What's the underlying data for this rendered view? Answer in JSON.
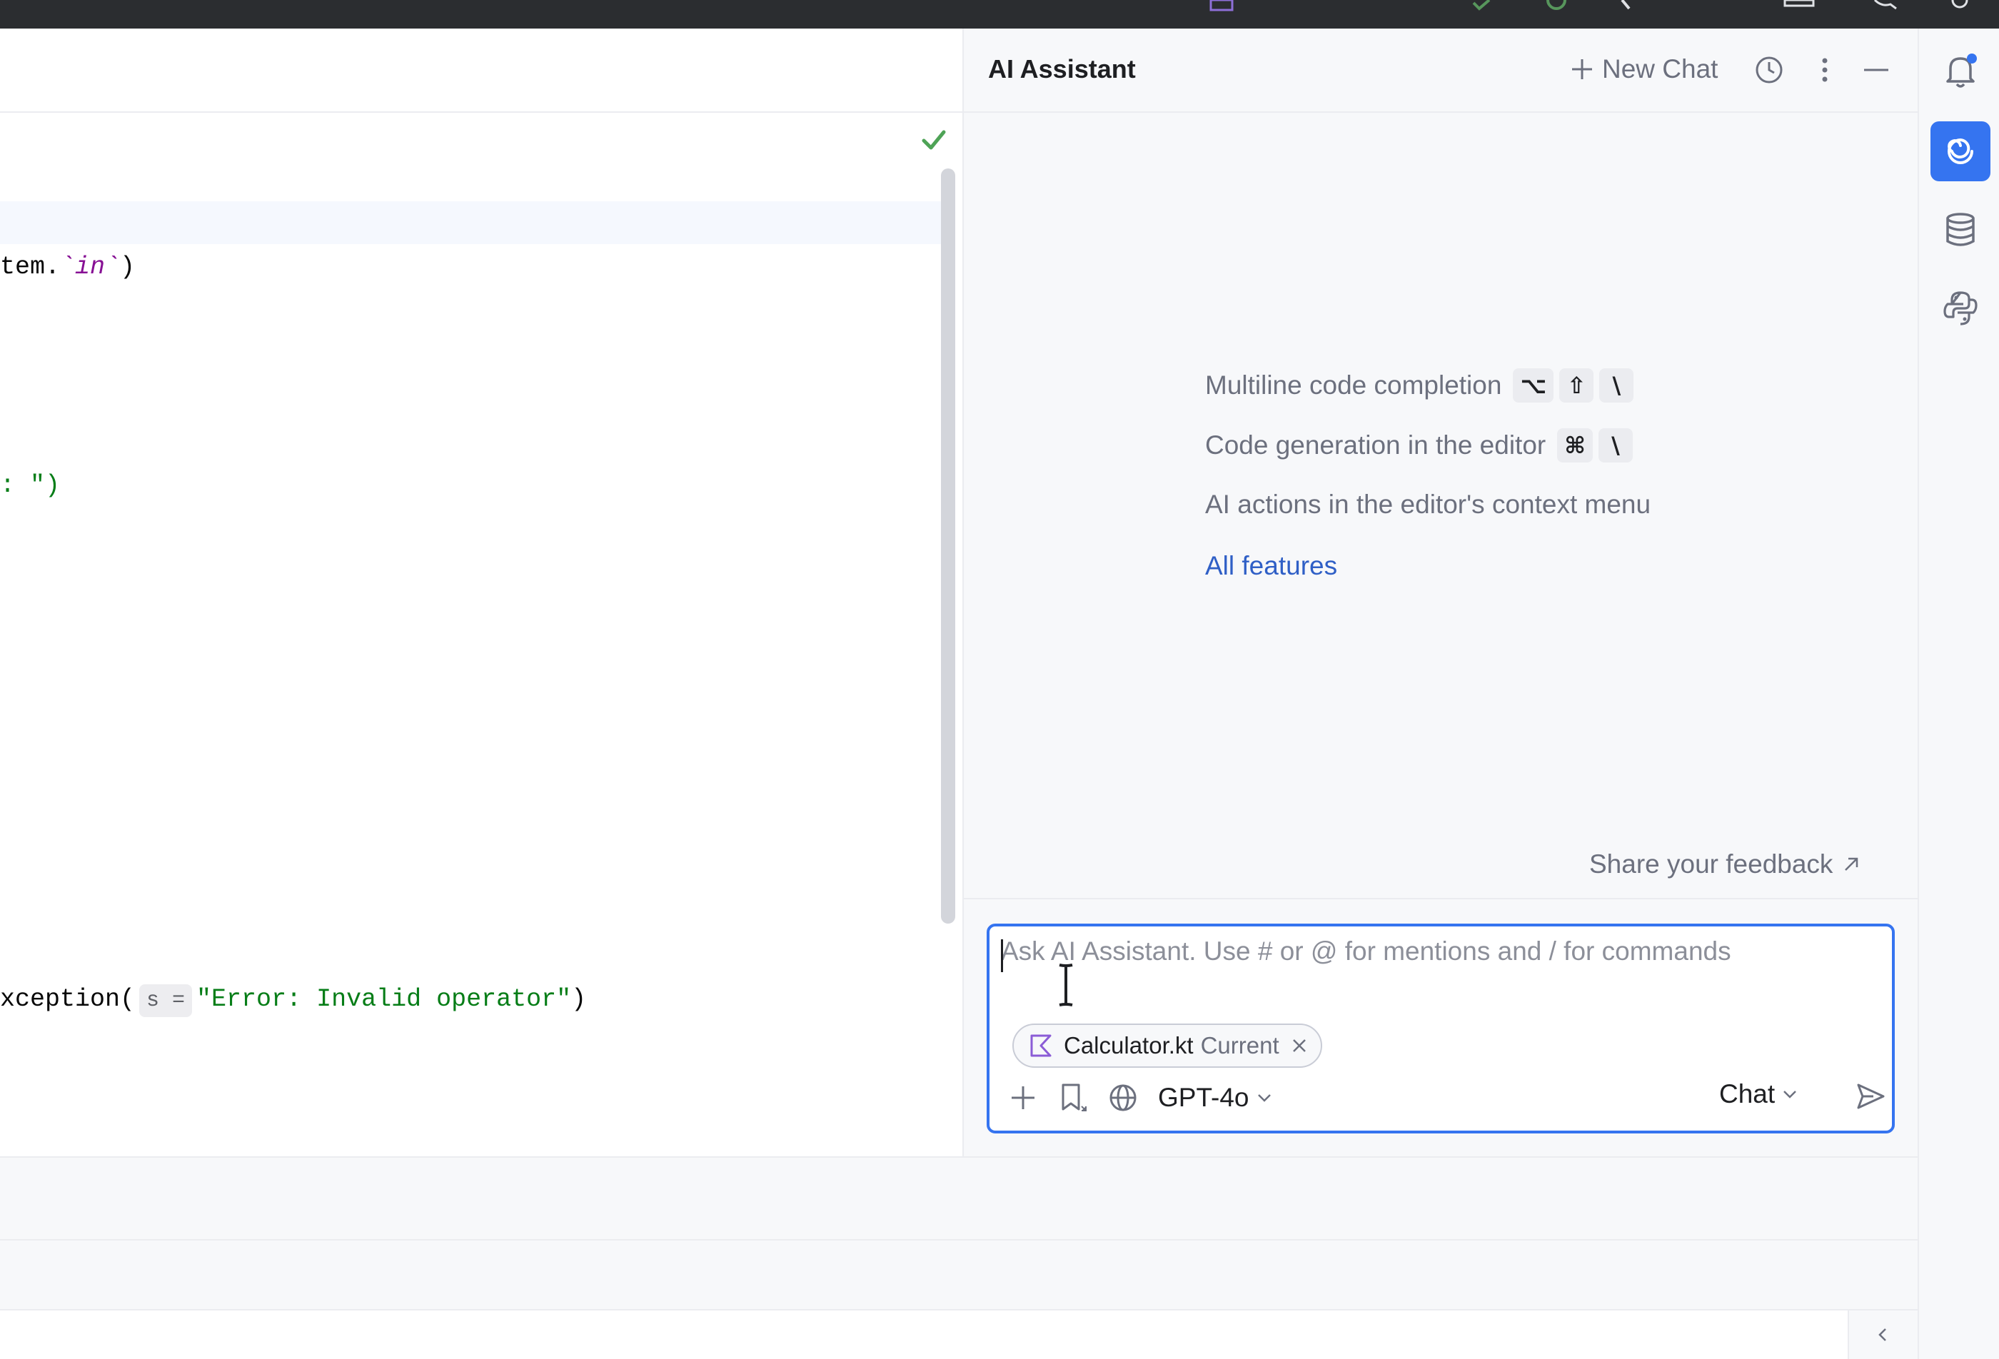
{
  "editor": {
    "lines": {
      "l1_a": "tem.",
      "l1_b": "`in`",
      "l1_c": ")",
      "l2_a": ": \")",
      "l3_a": "xception(",
      "l3_hint": "s =",
      "l3_str": "\"Error: Invalid operator\"",
      "l3_c": ")"
    }
  },
  "ai_panel": {
    "title": "AI Assistant",
    "new_chat_label": "New Chat",
    "features": {
      "multiline_label": "Multiline code completion",
      "multiline_keys": [
        "⌥",
        "⇧",
        "\\"
      ],
      "codegen_label": "Code generation in the editor",
      "codegen_keys": [
        "⌘",
        "\\"
      ],
      "actions_label": "AI actions in the editor's context menu",
      "all_features_link": "All features"
    },
    "feedback_label": "Share your feedback",
    "input": {
      "placeholder": "Ask AI Assistant. Use # or @ for mentions and / for commands",
      "context_chip": {
        "file": "Calculator.kt",
        "tag": "Current"
      },
      "model": "GPT-4o",
      "mode": "Chat"
    }
  },
  "colors": {
    "accent": "#3574f0",
    "link": "#2f5fc6",
    "string": "#067d17",
    "keyword": "#871094",
    "check": "#4ea356"
  },
  "icons": {
    "header": [
      "history-icon",
      "more-vertical-icon",
      "minimize-icon"
    ],
    "strip": [
      "notifications-icon",
      "ai-assistant-icon",
      "database-icon",
      "python-icon"
    ],
    "input_tools": [
      "add-context-icon",
      "prompt-library-icon",
      "web-search-icon"
    ]
  }
}
